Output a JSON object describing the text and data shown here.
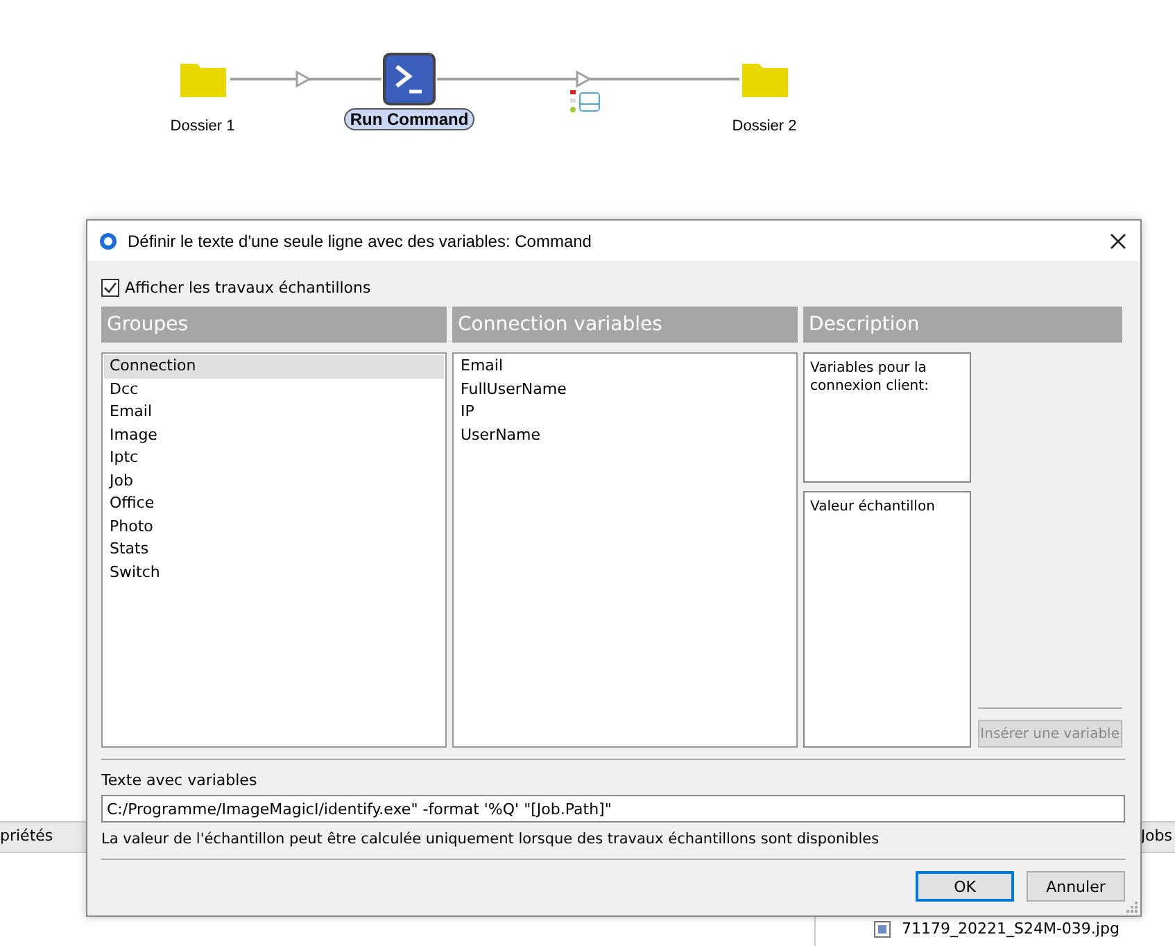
{
  "flow": {
    "nodes": [
      {
        "kind": "folder",
        "label": "Dossier 1",
        "selected": false
      },
      {
        "kind": "command",
        "label": "Run Command",
        "selected": true
      },
      {
        "kind": "folder",
        "label": "Dossier 2",
        "selected": false
      }
    ]
  },
  "background": {
    "left_tab": "priétés",
    "right_tab": "Jobs",
    "file_item": "71179_20221_S24M-039.jpg"
  },
  "dialog": {
    "title": "Définir le texte d'une seule ligne avec des variables: Command",
    "show_samples": {
      "label": "Afficher les travaux échantillons",
      "checked": true
    },
    "columns": [
      "Groupes",
      "Connection variables",
      "Description"
    ],
    "groups": [
      {
        "label": "Connection",
        "selected": true
      },
      {
        "label": "Dcc",
        "selected": false
      },
      {
        "label": "Email",
        "selected": false
      },
      {
        "label": "Image",
        "selected": false
      },
      {
        "label": "Iptc",
        "selected": false
      },
      {
        "label": "Job",
        "selected": false
      },
      {
        "label": "Office",
        "selected": false
      },
      {
        "label": "Photo",
        "selected": false
      },
      {
        "label": "Stats",
        "selected": false
      },
      {
        "label": "Switch",
        "selected": false
      }
    ],
    "variables": [
      {
        "label": "Email",
        "selected": false
      },
      {
        "label": "FullUserName",
        "selected": false
      },
      {
        "label": "IP",
        "selected": false
      },
      {
        "label": "UserName",
        "selected": false
      }
    ],
    "description": "Variables pour la connexion client:",
    "sample_label": "Valeur échantillon",
    "insert_button": {
      "label": "Insérer une variable",
      "disabled": true
    },
    "text_label": "Texte avec variables",
    "text_value": "C:/Programme/ImageMagicI/identify.exe\" -format '%Q' \"[Job.Path]\"",
    "note": "La valeur de l'échantillon peut être calculée uniquement lorsque des travaux échantillons sont disponibles",
    "buttons": [
      "OK",
      "Annuler"
    ]
  }
}
